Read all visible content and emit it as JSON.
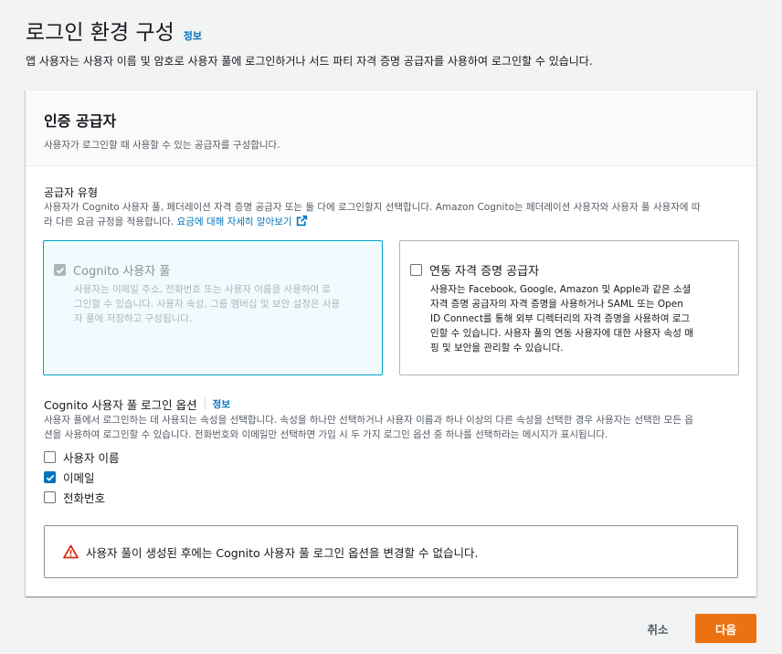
{
  "header": {
    "title": "로그인 환경 구성",
    "info": "정보",
    "description": "앱 사용자는 사용자 이름 및 암호로 사용자 풀에 로그인하거나 서드 파티 자격 증명 공급자를 사용하여 로그인할 수 있습니다."
  },
  "card": {
    "title": "인증 공급자",
    "description": "사용자가 로그인할 때 사용할 수 있는 공급자를 구성합니다."
  },
  "provider_type": {
    "label": "공급자 유형",
    "description_line1": "사용자가 Cognito 사용자 풀, 페더레이션 자격 증명 공급자 또는 둘 다에 로그인할지 선택합니다. Amazon Cognito는 페더레이션 사용자와 사용자 풀 사용자에 따",
    "description_line2": "라 다른 요금 규정을 적용합니다.",
    "pricing_link": "요금에 대해 자세히 알아보기",
    "tiles": [
      {
        "title": "Cognito 사용자 풀",
        "description": [
          "사용자는 이메일 주소, 전화번호 또는 사용자 이름을 사용하여 로",
          "그인할 수 있습니다. 사용자 속성, 그룹 멤버십 및 보안 설정은 사용",
          "자 풀에 저장하고 구성됩니다."
        ],
        "checked": true,
        "disabled": true
      },
      {
        "title": "연동 자격 증명 공급자",
        "description": [
          "사용자는 Facebook, Google, Amazon 및 Apple과 같은 소셜",
          "자격 증명 공급자의 자격 증명을 사용하거나 SAML 또는 Open",
          "ID Connect를 통해 외부 디렉터리의 자격 증명을 사용하여 로그",
          "인할 수 있습니다. 사용자 풀의 연동 사용자에 대한 사용자 속성 매",
          "핑 및 보안을 관리할 수 있습니다."
        ],
        "checked": false,
        "disabled": false
      }
    ]
  },
  "signin_options": {
    "title": "Cognito 사용자 풀 로그인 옵션",
    "info": "정보",
    "description_line1": "사용자 풀에서 로그인하는 데 사용되는 속성을 선택합니다. 속성을 하나만 선택하거나 사용자 이름과 하나 이상의 다른 속성을 선택한 경우 사용자는 선택한 모든 옵",
    "description_line2": "션을 사용하여 로그인할 수 있습니다. 전화번호와 이메일만 선택하면 가입 시 두 가지 로그인 옵션 중 하나를 선택하라는 메시지가 표시됩니다.",
    "options": [
      {
        "label": "사용자 이름",
        "checked": false
      },
      {
        "label": "이메일",
        "checked": true
      },
      {
        "label": "전화번호",
        "checked": false
      }
    ]
  },
  "alert": {
    "icon": "warning-icon",
    "message": "사용자 풀이 생성된 후에는 Cognito 사용자 풀 로그인 옵션을 변경할 수 없습니다."
  },
  "footer": {
    "cancel": "취소",
    "next": "다음"
  },
  "colors": {
    "accent": "#0073bb",
    "primary_button": "#ec7211",
    "warning": "#d13212",
    "selected_tile_bg": "#f1faff",
    "selected_tile_border": "#00a1c9"
  }
}
